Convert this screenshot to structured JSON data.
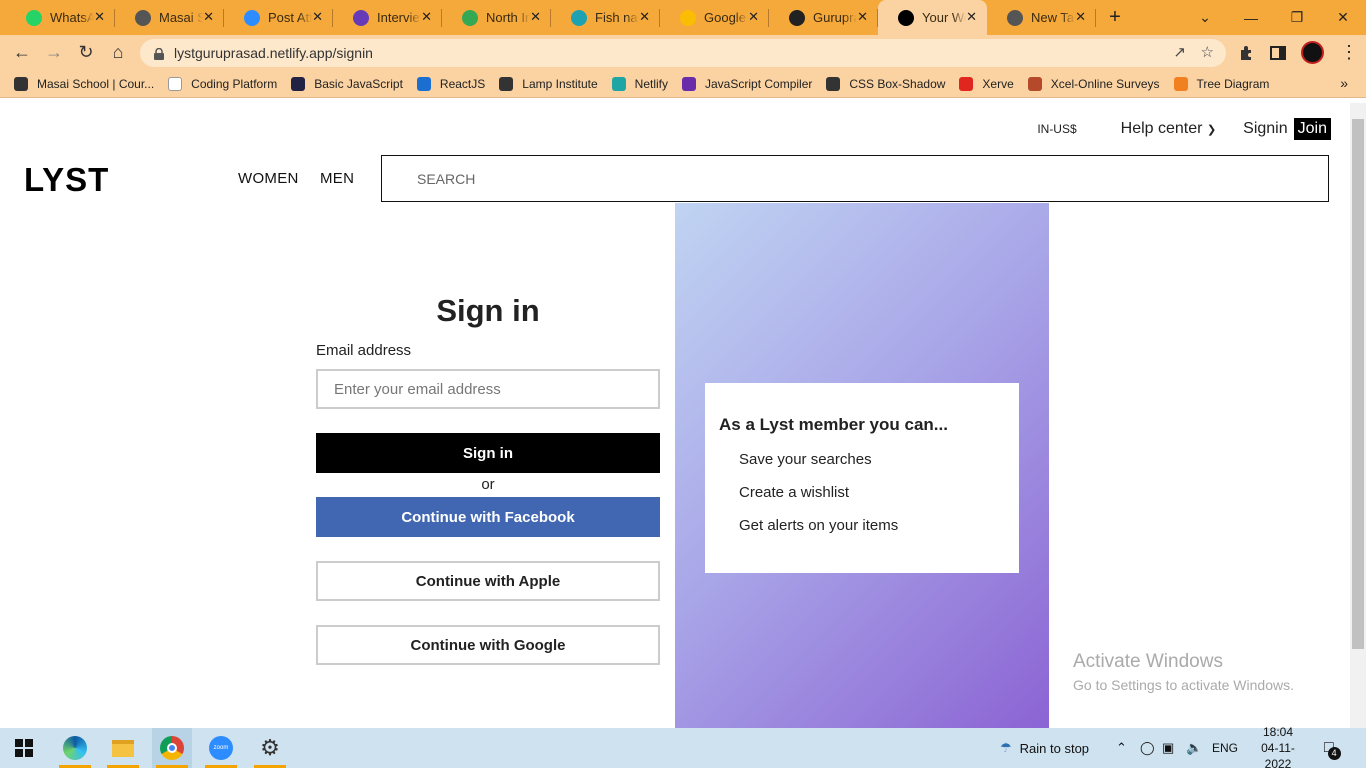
{
  "browser": {
    "tabs": [
      {
        "title": "WhatsApp",
        "icon": "whatsapp-icon",
        "color": "#25d366"
      },
      {
        "title": "Masai School",
        "icon": "globe-icon",
        "color": "#555555"
      },
      {
        "title": "Post Attendance",
        "icon": "zoom-icon",
        "color": "#2d8cff"
      },
      {
        "title": "Interview",
        "icon": "form-icon",
        "color": "#673ab7"
      },
      {
        "title": "North India",
        "icon": "maps-icon",
        "color": "#34a853"
      },
      {
        "title": "Fish names",
        "icon": "umbrella-icon",
        "color": "#1ea2b1"
      },
      {
        "title": "Google Keep",
        "icon": "keep-icon",
        "color": "#fbbc04"
      },
      {
        "title": "Guruprasad",
        "icon": "github-icon",
        "color": "#222222"
      },
      {
        "title": "Your Workspace",
        "icon": "lyst-icon",
        "color": "#000000",
        "active": true
      },
      {
        "title": "New Tab",
        "icon": "chrome-icon",
        "color": "#555555"
      }
    ],
    "url": "lystguruprasad.netlify.app/signin",
    "bookmarks": [
      {
        "label": "Masai School | Cour...",
        "icon": "globe-icon",
        "color": "#333333"
      },
      {
        "label": "Coding Platform",
        "icon": "masai-icon",
        "color": "#ffffff"
      },
      {
        "label": "Basic JavaScript",
        "icon": "javascript-icon",
        "color": "#222244"
      },
      {
        "label": "ReactJS",
        "icon": "edge-icon",
        "color": "#1b6fd1"
      },
      {
        "label": "Lamp Institute",
        "icon": "lamp-icon",
        "color": "#333333"
      },
      {
        "label": "Netlify",
        "icon": "netlify-icon",
        "color": "#20a5a5"
      },
      {
        "label": "JavaScript Compiler",
        "icon": "compiler-icon",
        "color": "#6a2ca8"
      },
      {
        "label": "CSS Box-Shadow",
        "icon": "css-icon",
        "color": "#333333"
      },
      {
        "label": "Xerve",
        "icon": "xerve-icon",
        "color": "#e0261e"
      },
      {
        "label": "Xcel-Online Surveys",
        "icon": "survey-icon",
        "color": "#b44a2a"
      },
      {
        "label": "Tree Diagram",
        "icon": "tree-icon",
        "color": "#f08020"
      }
    ]
  },
  "site": {
    "currency": "IN-US$",
    "help": "Help center",
    "signin_link": "Signin",
    "join": "Join",
    "logo": "LYST",
    "nav": [
      "WOMEN",
      "MEN"
    ],
    "search_placeholder": "SEARCH"
  },
  "form": {
    "title": "Sign in",
    "email_label": "Email address",
    "email_placeholder": "Enter your email address",
    "signin_button": "Sign in",
    "or": "or",
    "facebook": "Continue with Facebook",
    "apple": "Continue with Apple",
    "google": "Continue with Google"
  },
  "promo": {
    "heading": "As a Lyst member you can...",
    "items": [
      "Save your searches",
      "Create a wishlist",
      "Get alerts on your items"
    ]
  },
  "watermark": {
    "title": "Activate Windows",
    "subtitle": "Go to Settings to activate Windows."
  },
  "taskbar": {
    "weather": "Rain to stop",
    "lang": "ENG",
    "time": "18:04",
    "date": "04-11-2022",
    "notifications": "4"
  },
  "colors": {
    "tabbar": "#f6a93b",
    "facebook": "#4267b2",
    "promo_start": "#c0d4f2",
    "promo_end": "#8b63d3"
  }
}
